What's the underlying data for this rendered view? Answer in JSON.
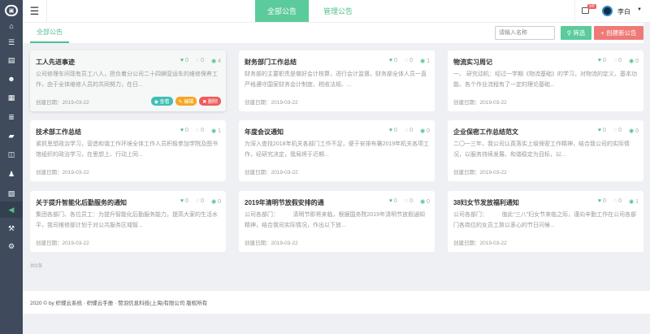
{
  "sidebar": {
    "icons": [
      "home-icon",
      "list-icon",
      "briefcase-icon",
      "users-icon",
      "calendar-icon",
      "table-icon",
      "book-icon",
      "columns-icon",
      "person-icon",
      "image-icon",
      "megaphone-icon",
      "gavel-icon",
      "cogs-icon"
    ],
    "active": "megaphone-icon"
  },
  "header": {
    "tabs": [
      {
        "label": "全部公告",
        "active": true
      },
      {
        "label": "管理公告",
        "active": false
      }
    ],
    "notification_count": "58",
    "user_name": "李白"
  },
  "toolbar": {
    "tab": "全部公告",
    "search_placeholder": "请输入名称",
    "search_value": "",
    "filter_label": "筛选",
    "create_label": "创建新公告"
  },
  "cards": [
    {
      "title": "工人先进事迹",
      "likes": "0",
      "comments": "0",
      "views": "4",
      "desc": "公司修理车间现有员工八人，担负着分公司二十四辆营运车的维修保养工作，由于全体维修人员的共同努力，在日...",
      "date": "创建日期：2019-03-22",
      "actions": {
        "view": "查看",
        "edit": "编辑",
        "delete": "删除"
      }
    },
    {
      "title": "财务部门工作总结",
      "likes": "0",
      "comments": "0",
      "views": "1",
      "desc": "财务部的主要职责是做好会计核算，进行会计监督。财务部全体人员一直严格遵守国家财务会计制度、税收法规、...",
      "date": "创建日期：2019-03-22"
    },
    {
      "title": "物流实习周记",
      "likes": "0",
      "comments": "0",
      "views": "0",
      "desc": "一、 研究动机：经过一学期《物流基础》的学习，对物流的定义、基本功能、各个作业流程有了一定的理论基础...",
      "date": "创建日期：2019-03-22"
    },
    {
      "title": "技术部工作总结",
      "likes": "0",
      "comments": "0",
      "views": "1",
      "desc": "紧抓思想政治学习，营造和谐工作环境全体工作人员积极参加学院及图书馆组织的政治学习，在思想上、行动上同...",
      "date": "创建日期：2019-03-22"
    },
    {
      "title": "年度会议通知",
      "likes": "0",
      "comments": "0",
      "views": "0",
      "desc": "为深入查找2018年机关各部门工作不足，便于安排布署2019年机关各项工作，经研究决定，我局将于近期...",
      "date": "创建日期：2019-03-22"
    },
    {
      "title": "企业保密工作总结范文",
      "likes": "0",
      "comments": "0",
      "views": "0",
      "desc": "二〇一三年，我公司认真落实上级保密工作精神，结合我公司的实际情况，以服务持续发展、和谐稳定为目标，以...",
      "date": "创建日期：2019-03-22"
    },
    {
      "title": "关于提升智能化后勤服务的通知",
      "likes": "0",
      "comments": "0",
      "views": "0",
      "desc": "集团各部门、各位员工：为提升智能化后勤服务能力，提高大家的生活水平，我司维修部计划于对公共服务区域智...",
      "date": "创建日期：2019-03-22"
    },
    {
      "title": "2019年清明节放假安排的通",
      "likes": "0",
      "comments": "0",
      "views": "0",
      "desc": "公司各部门：　　　清明节即将来临，根据国务院2019年清明节放假通知精神，结合我司实际情况，作出以下放...",
      "date": "创建日期：2019-03-22"
    },
    {
      "title": "38妇女节发放福利通知",
      "likes": "0",
      "comments": "0",
      "views": "1",
      "desc": "公司各部门：　　　值此“三八”妇女节来临之际，谨向辛勤工作在公司各部门各岗位的女员工致以衷心的节日问候...",
      "date": "创建日期：2019-03-22"
    }
  ],
  "count_text": "共9条",
  "footer": "2020 © by 织蝶云系统 · 织蝶云手册 · 赞羽信息科技(上海)有限公司 版权所有",
  "colors": {
    "accent": "#5ccb9c",
    "danger": "#ee7a76",
    "sidebar": "#3f4b5d"
  }
}
